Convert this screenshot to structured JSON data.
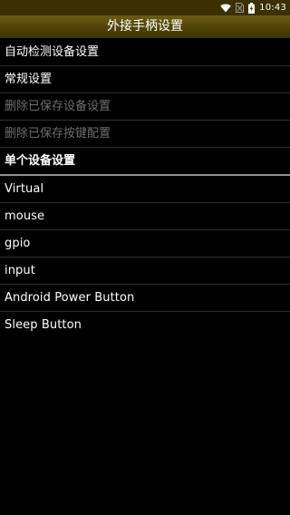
{
  "status_bar": {
    "time": "10:43",
    "icons": [
      "wifi-icon",
      "sim-no-signal-icon",
      "battery-charging-icon"
    ]
  },
  "app_bar": {
    "title": "外接手柄设置"
  },
  "settings": [
    {
      "label": "自动检测设备设置",
      "enabled": true
    },
    {
      "label": "常规设置",
      "enabled": true
    },
    {
      "label": "删除已保存设备设置",
      "enabled": false
    },
    {
      "label": "删除已保存按键配置",
      "enabled": false
    }
  ],
  "device_section": {
    "header": "单个设备设置",
    "devices": [
      {
        "label": "Virtual"
      },
      {
        "label": "mouse"
      },
      {
        "label": "gpio"
      },
      {
        "label": "input"
      },
      {
        "label": "Android Power Button"
      },
      {
        "label": "Sleep Button"
      }
    ]
  },
  "colors": {
    "background": "#000000",
    "app_bar": "#4f4309",
    "status_bar": "#3a3000",
    "text": "#ffffff",
    "disabled_text": "#6f6f6f",
    "divider": "#2e2e2e"
  }
}
